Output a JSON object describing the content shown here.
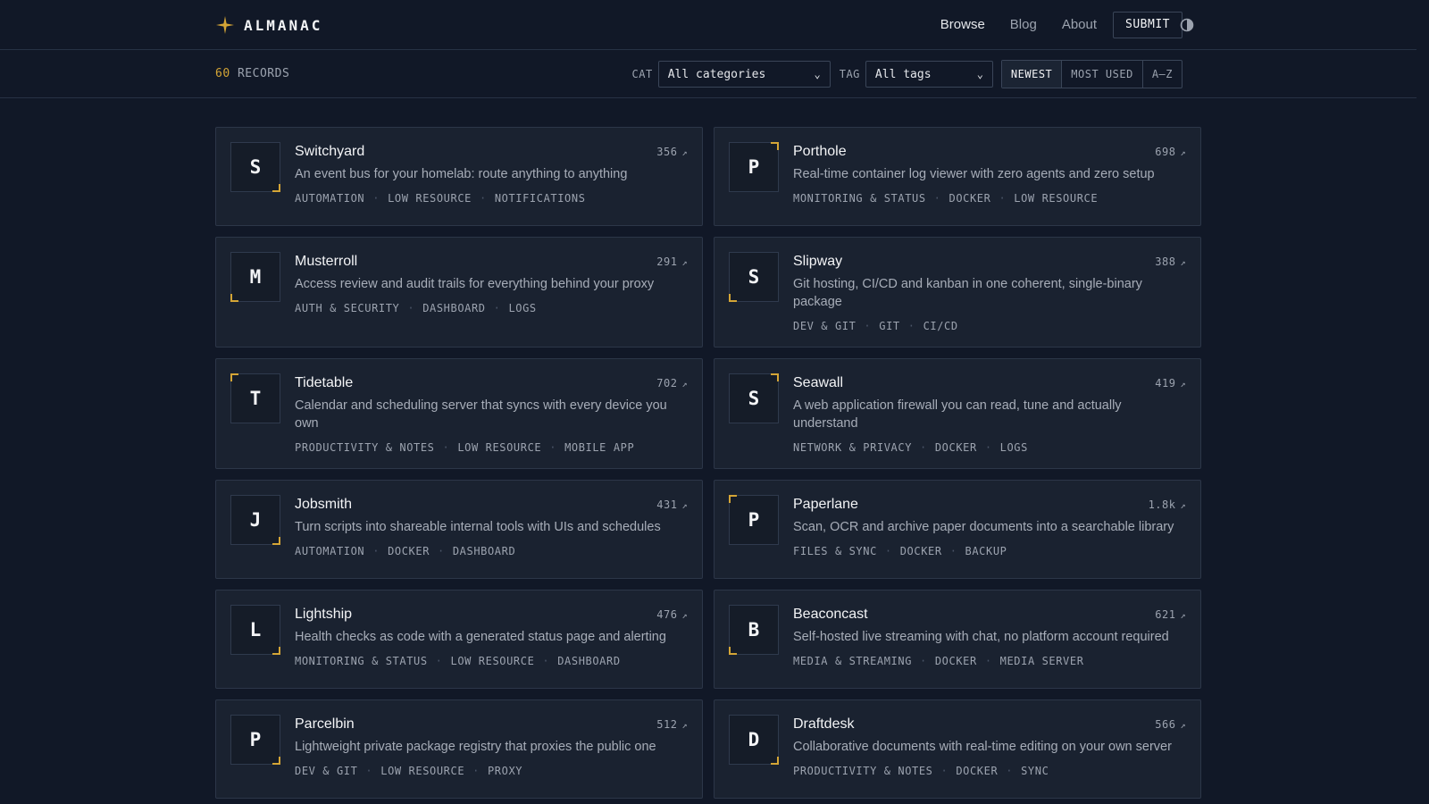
{
  "header": {
    "brand": "ALMANAC",
    "nav": [
      {
        "label": "Browse",
        "active": true
      },
      {
        "label": "Blog",
        "active": false
      },
      {
        "label": "About",
        "active": false
      }
    ],
    "submit_label": "SUBMIT",
    "theme_icon": "contrast-icon"
  },
  "filters": {
    "records_count": "60",
    "records_label": "RECORDS",
    "cat_label": "CAT",
    "cat_value": "All categories",
    "tag_label": "TAG",
    "tag_value": "All tags",
    "sort_options": [
      "NEWEST",
      "MOST USED",
      "A–Z"
    ],
    "sort_active": "NEWEST"
  },
  "colors": {
    "accent": "#d4a536",
    "background": "#111827",
    "card": "#1a2230"
  },
  "cards": [
    {
      "initial": "S",
      "name": "Switchyard",
      "count": "356",
      "corner": "br",
      "desc": "An event bus for your homelab: route anything to anything",
      "tags": [
        "AUTOMATION",
        "LOW RESOURCE",
        "NOTIFICATIONS"
      ]
    },
    {
      "initial": "P",
      "name": "Porthole",
      "count": "698",
      "corner": "tr",
      "desc": "Real-time container log viewer with zero agents and zero setup",
      "tags": [
        "MONITORING & STATUS",
        "DOCKER",
        "LOW RESOURCE"
      ]
    },
    {
      "initial": "M",
      "name": "Musterroll",
      "count": "291",
      "corner": "bl",
      "desc": "Access review and audit trails for everything behind your proxy",
      "tags": [
        "AUTH & SECURITY",
        "DASHBOARD",
        "LOGS"
      ]
    },
    {
      "initial": "S",
      "name": "Slipway",
      "count": "388",
      "corner": "bl",
      "desc": "Git hosting, CI/CD and kanban in one coherent, single-binary package",
      "tags": [
        "DEV & GIT",
        "GIT",
        "CI/CD"
      ]
    },
    {
      "initial": "T",
      "name": "Tidetable",
      "count": "702",
      "corner": "tl",
      "desc": "Calendar and scheduling server that syncs with every device you own",
      "tags": [
        "PRODUCTIVITY & NOTES",
        "LOW RESOURCE",
        "MOBILE APP"
      ]
    },
    {
      "initial": "S",
      "name": "Seawall",
      "count": "419",
      "corner": "tr",
      "desc": "A web application firewall you can read, tune and actually understand",
      "tags": [
        "NETWORK & PRIVACY",
        "DOCKER",
        "LOGS"
      ]
    },
    {
      "initial": "J",
      "name": "Jobsmith",
      "count": "431",
      "corner": "br",
      "desc": "Turn scripts into shareable internal tools with UIs and schedules",
      "tags": [
        "AUTOMATION",
        "DOCKER",
        "DASHBOARD"
      ]
    },
    {
      "initial": "P",
      "name": "Paperlane",
      "count": "1.8k",
      "corner": "tl",
      "desc": "Scan, OCR and archive paper documents into a searchable library",
      "tags": [
        "FILES & SYNC",
        "DOCKER",
        "BACKUP"
      ]
    },
    {
      "initial": "L",
      "name": "Lightship",
      "count": "476",
      "corner": "br",
      "desc": "Health checks as code with a generated status page and alerting",
      "tags": [
        "MONITORING & STATUS",
        "LOW RESOURCE",
        "DASHBOARD"
      ]
    },
    {
      "initial": "B",
      "name": "Beaconcast",
      "count": "621",
      "corner": "bl",
      "desc": "Self-hosted live streaming with chat, no platform account required",
      "tags": [
        "MEDIA & STREAMING",
        "DOCKER",
        "MEDIA SERVER"
      ]
    },
    {
      "initial": "P",
      "name": "Parcelbin",
      "count": "512",
      "corner": "br",
      "desc": "Lightweight private package registry that proxies the public one",
      "tags": [
        "DEV & GIT",
        "LOW RESOURCE",
        "PROXY"
      ]
    },
    {
      "initial": "D",
      "name": "Draftdesk",
      "count": "566",
      "corner": "br",
      "desc": "Collaborative documents with real-time editing on your own server",
      "tags": [
        "PRODUCTIVITY & NOTES",
        "DOCKER",
        "SYNC"
      ]
    }
  ]
}
